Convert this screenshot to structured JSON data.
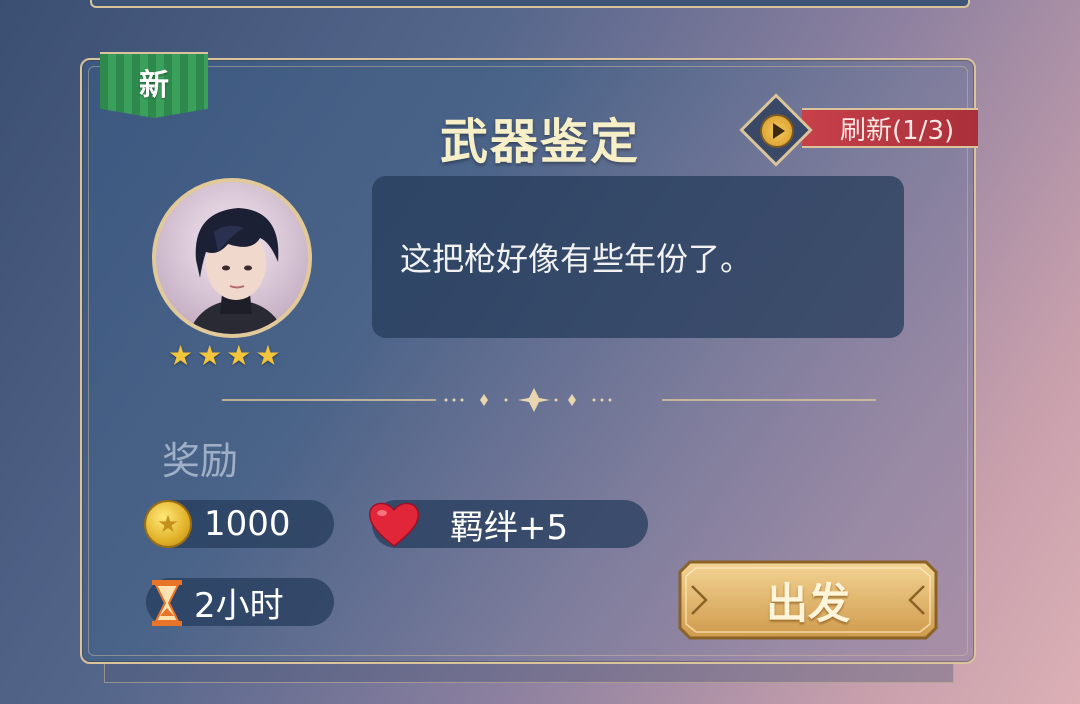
{
  "card": {
    "new_tag": "新",
    "title": "武器鉴定",
    "refresh": {
      "label": "刷新(1/3)"
    },
    "character": {
      "stars": 4
    },
    "dialogue": "这把枪好像有些年份了。",
    "rewards": {
      "label": "奖励",
      "gold": "1000",
      "bond": "羁绊+5",
      "duration": "2小时"
    },
    "go_button": "出发"
  },
  "colors": {
    "accent_gold": "#d9c49b",
    "title_text": "#f6efc7",
    "new_tag_green": "#2e8a4c",
    "refresh_red": "#c7404a",
    "star_yellow": "#f3c53c"
  },
  "icons": [
    "star-icon",
    "play-icon",
    "coin-icon",
    "heart-icon",
    "hourglass-icon"
  ]
}
